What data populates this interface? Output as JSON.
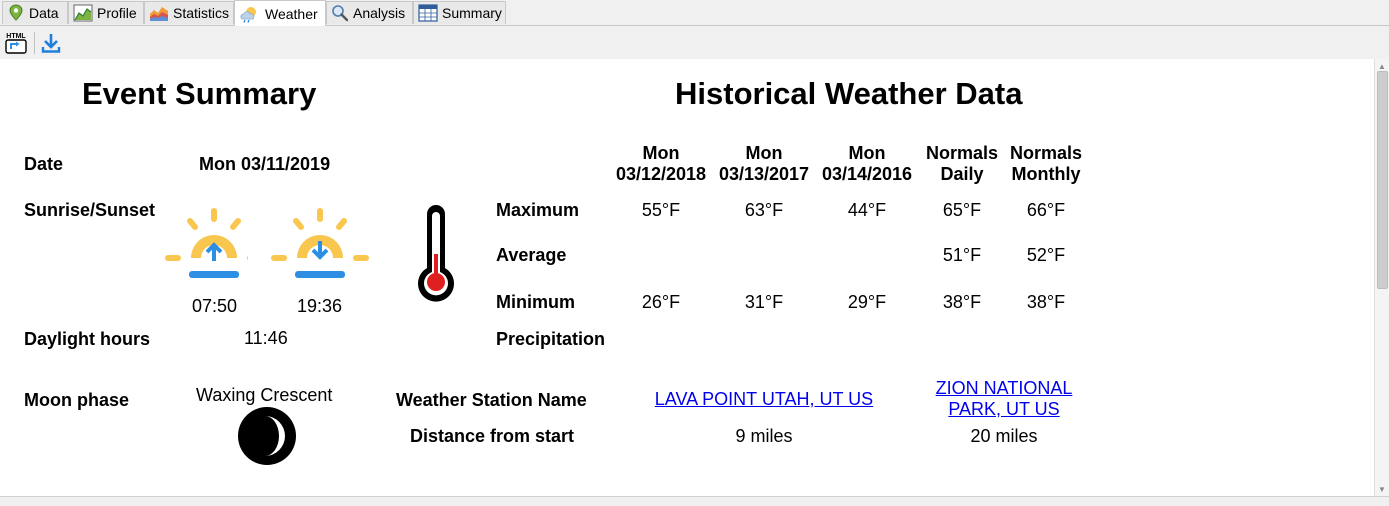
{
  "tabs": [
    {
      "label": "Data",
      "icon": "map-pin-icon"
    },
    {
      "label": "Profile",
      "icon": "profile-chart-icon"
    },
    {
      "label": "Statistics",
      "icon": "statistics-chart-icon"
    },
    {
      "label": "Weather",
      "icon": "weather-cloud-icon",
      "active": true
    },
    {
      "label": "Analysis",
      "icon": "magnifier-icon"
    },
    {
      "label": "Summary",
      "icon": "table-icon"
    }
  ],
  "toolbar": {
    "html_button_text": "HTML",
    "html_button_icon": "html-export-icon",
    "download_icon": "download-icon"
  },
  "event_summary": {
    "title": "Event Summary",
    "date_label": "Date",
    "date_value": "Mon 03/11/2019",
    "sunrise_sunset_label": "Sunrise/Sunset",
    "sunrise_time": "07:50",
    "sunset_time": "19:36",
    "daylight_label": "Daylight hours",
    "daylight_value": "11:46",
    "moon_label": "Moon phase",
    "moon_value": "Waxing Crescent"
  },
  "historical": {
    "title": "Historical Weather Data",
    "columns": [
      {
        "line1": "Mon",
        "line2": "03/12/2018"
      },
      {
        "line1": "Mon",
        "line2": "03/13/2017"
      },
      {
        "line1": "Mon",
        "line2": "03/14/2016"
      },
      {
        "line1": "Normals",
        "line2": "Daily"
      },
      {
        "line1": "Normals",
        "line2": "Monthly"
      }
    ],
    "rows": {
      "maximum": {
        "label": "Maximum",
        "values": [
          "55°F",
          "63°F",
          "44°F",
          "65°F",
          "66°F"
        ]
      },
      "average": {
        "label": "Average",
        "values": [
          "",
          "",
          "",
          "51°F",
          "52°F"
        ]
      },
      "minimum": {
        "label": "Minimum",
        "values": [
          "26°F",
          "31°F",
          "29°F",
          "38°F",
          "38°F"
        ]
      },
      "precipitation": {
        "label": "Precipitation",
        "values": [
          "",
          "",
          "",
          "",
          ""
        ]
      }
    },
    "station_label": "Weather Station Name",
    "distance_label": "Distance from start",
    "stations": [
      {
        "name": "LAVA POINT UTAH, UT US",
        "distance": "9 miles"
      },
      {
        "name_line1": "ZION NATIONAL",
        "name_line2": "PARK, UT US",
        "distance": "20 miles"
      }
    ]
  },
  "colors": {
    "sun_yellow": "#f9c74f",
    "sun_arrow_blue": "#2d8fe3",
    "thermometer_red": "#e02020",
    "link_blue": "#0000ee"
  }
}
